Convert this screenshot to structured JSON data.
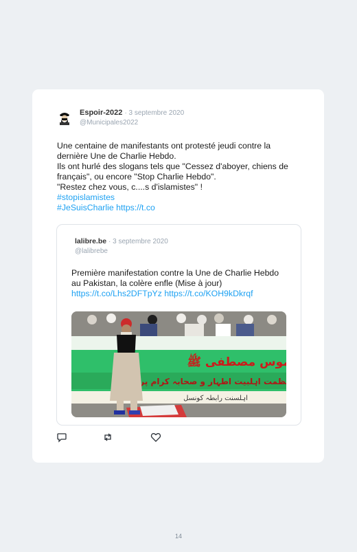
{
  "tweet": {
    "author_name": "Espoir-2022",
    "date": "· 3 septembre 2020",
    "handle": "@Municipales2022",
    "lines": [
      "Une centaine de manifestants ont protesté jeudi contre la dernière Une de Charlie Hebdo.",
      "Ils ont hurlé des slogans tels que \"Cessez d'aboyer, chiens de français\", ou encore \"Stop Charlie Hebdo\".",
      "\"Restez chez vous, c....s d'islamistes\" !"
    ],
    "hashtag1": "#stopislamistes",
    "hashtag2": "#JeSuisCharlie",
    "link": "https://t.co"
  },
  "quoted": {
    "author_name": "lalibre.be",
    "date": "· 3 septembre 2020",
    "handle": "@lalibrebe",
    "text": "Première manifestation contre la Une de Charlie Hebdo au Pakistan, la colère enfle (Mise à jour)",
    "link1": "https://t.co/Lhs2DFTpYz",
    "link2": "https://t.co/KOH9kDkrqf",
    "photo_alt": "Protesters holding a green banner with Urdu text; a man in a black vest stands in front",
    "banner_lines": [
      "ناموس مصطفی ﷺ",
      "عظمت اہلبیت اطہار و صحابہ کرام پر",
      "اہلسنت رابطہ کونسل"
    ]
  },
  "actions": {
    "reply_icon": "reply-icon",
    "retweet_icon": "retweet-icon",
    "like_icon": "heart-icon"
  },
  "page_number": "14",
  "colors": {
    "background": "#edf0f3",
    "card": "#ffffff",
    "link": "#1da1f2",
    "muted": "#9aa5b1"
  }
}
